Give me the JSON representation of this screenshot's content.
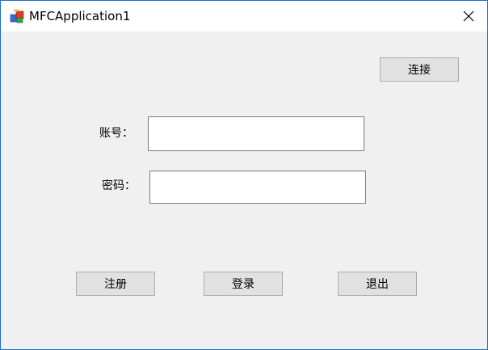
{
  "window": {
    "title": "MFCApplication1",
    "app_icon": "mfc-app-icon",
    "close_icon": "close-icon",
    "accent_border": "#1c6fc7",
    "client_background": "#f0f0f0"
  },
  "form": {
    "connect_label": "连接",
    "account_label": "账号：",
    "account_value": "",
    "password_label": "密码：",
    "password_value": "",
    "register_label": "注册",
    "login_label": "登录",
    "exit_label": "退出"
  }
}
